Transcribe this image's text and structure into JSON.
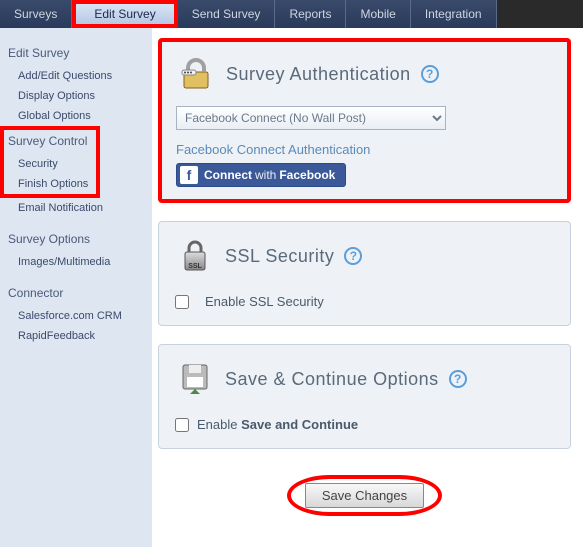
{
  "topnav": {
    "tabs": [
      "Surveys",
      "Edit Survey",
      "Send Survey",
      "Reports",
      "Mobile",
      "Integration"
    ],
    "active_index": 1
  },
  "sidebar": {
    "groups": [
      {
        "title": "Edit Survey",
        "items": [
          "Add/Edit Questions",
          "Display Options",
          "Global Options"
        ]
      },
      {
        "title": "Survey Control",
        "items": [
          "Security",
          "Finish Options",
          "Email Notification"
        ]
      },
      {
        "title": "Survey Options",
        "items": [
          "Images/Multimedia"
        ]
      },
      {
        "title": "Connector",
        "items": [
          "Salesforce.com CRM",
          "RapidFeedback"
        ]
      }
    ]
  },
  "panels": {
    "auth": {
      "title": "Survey Authentication",
      "dropdown_value": "Facebook Connect (No Wall Post)",
      "sub": "Facebook Connect Authentication",
      "fb_button_connect": "Connect",
      "fb_button_with": "with",
      "fb_button_brand": "Facebook"
    },
    "ssl": {
      "title": "SSL Security",
      "checkbox_label": "Enable SSL Security"
    },
    "save_continue": {
      "title": "Save & Continue Options",
      "checkbox_prefix": "Enable ",
      "checkbox_strong": "Save and Continue"
    }
  },
  "save_button": "Save Changes"
}
